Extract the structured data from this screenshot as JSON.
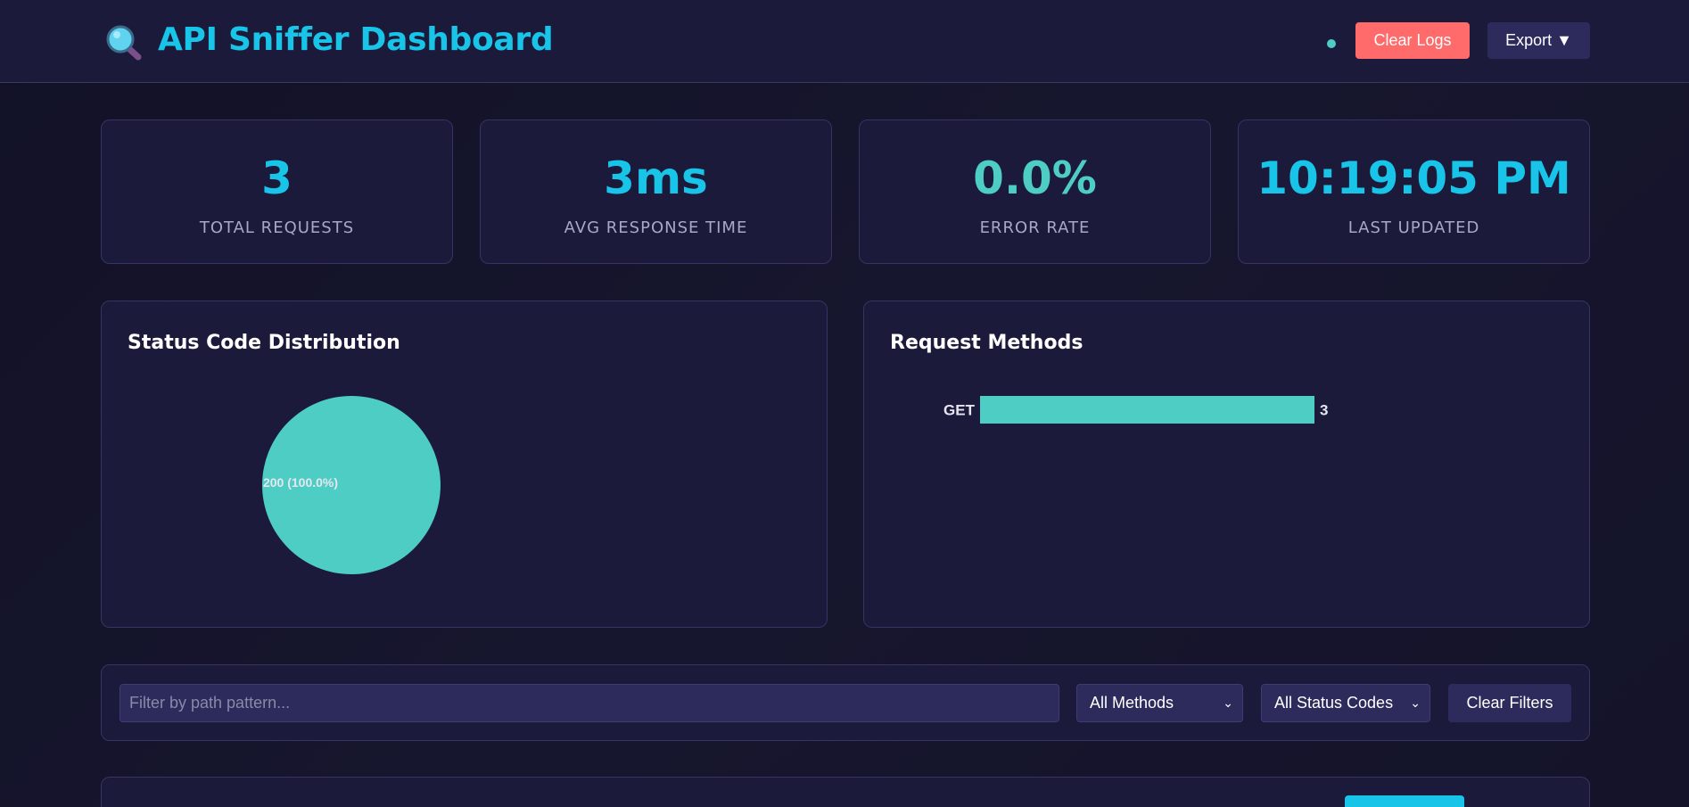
{
  "header": {
    "title": "API Sniffer Dashboard",
    "logo_icon": "magnifying-glass-icon",
    "clear_logs_label": "Clear Logs",
    "export_label": "Export ▼",
    "status_dot_color": "#4ecdc4"
  },
  "stats": [
    {
      "value": "3",
      "label": "TOTAL REQUESTS"
    },
    {
      "value": "3ms",
      "label": "AVG RESPONSE TIME"
    },
    {
      "value": "0.0%",
      "label": "ERROR RATE"
    },
    {
      "value": "10:19:05 PM",
      "label": "LAST UPDATED"
    }
  ],
  "charts": {
    "status_title": "Status Code Distribution",
    "methods_title": "Request Methods"
  },
  "chart_data": [
    {
      "type": "pie",
      "title": "Status Code Distribution",
      "slices": [
        {
          "label": "200 (100.0%)",
          "category": "200",
          "value": 100.0
        }
      ],
      "colors": [
        "#4ecdc4"
      ]
    },
    {
      "type": "bar",
      "orientation": "horizontal",
      "title": "Request Methods",
      "categories": [
        "GET"
      ],
      "values": [
        3
      ],
      "colors": [
        "#4ecdc4"
      ]
    }
  ],
  "filters": {
    "path_placeholder": "Filter by path pattern...",
    "method_selected": "All Methods",
    "status_selected": "All Status Codes",
    "clear_label": "Clear Filters"
  },
  "colors": {
    "accent": "#18c5e8",
    "teal": "#4ecdc4",
    "danger": "#ff6b6b",
    "panel": "#1b1a3b"
  }
}
